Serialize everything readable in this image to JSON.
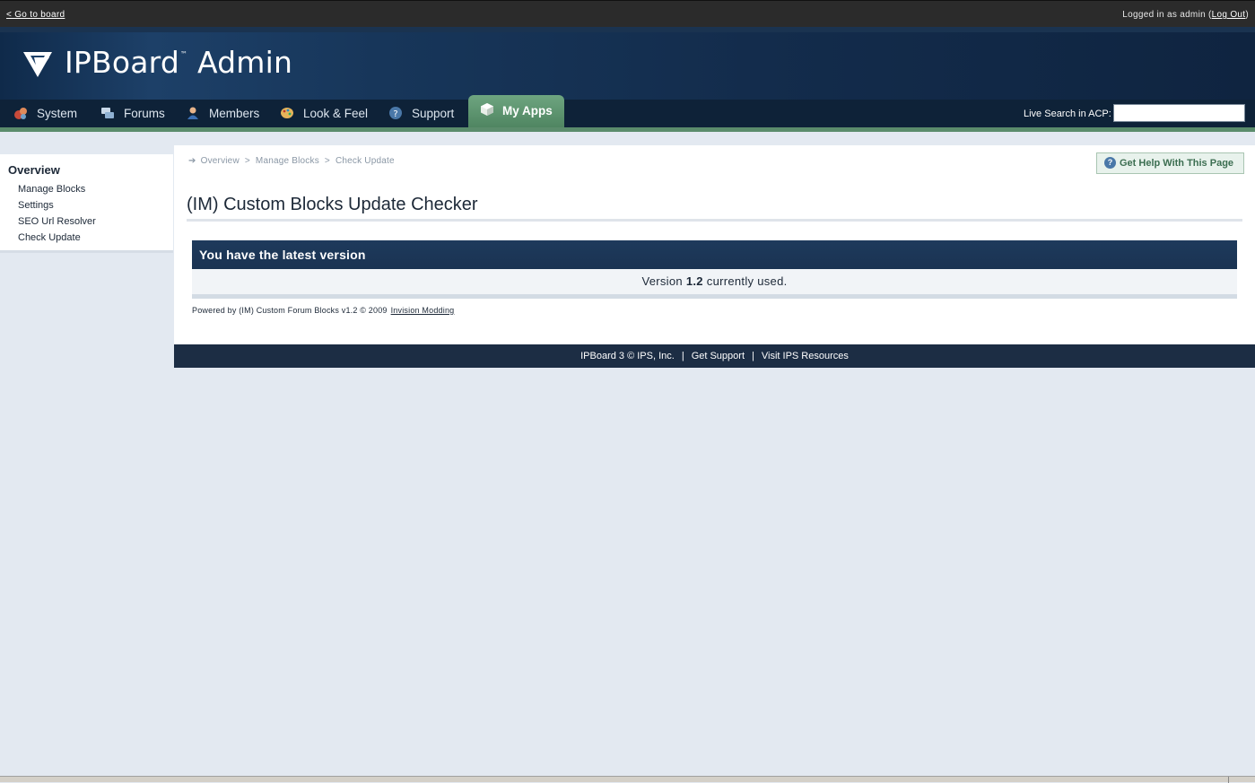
{
  "topbar": {
    "go_to_board": "< Go to board",
    "logged_in_prefix": "Logged in as admin (",
    "logout": "Log Out",
    "logged_in_suffix": ")"
  },
  "header": {
    "logo_text": "IPBoard",
    "logo_tm": "™",
    "logo_admin": "Admin"
  },
  "nav": {
    "tabs": [
      {
        "label": "System",
        "icon": "system-icon"
      },
      {
        "label": "Forums",
        "icon": "forums-icon"
      },
      {
        "label": "Members",
        "icon": "members-icon"
      },
      {
        "label": "Look & Feel",
        "icon": "look-feel-icon"
      },
      {
        "label": "Support",
        "icon": "support-icon"
      },
      {
        "label": "My Apps",
        "icon": "my-apps-icon",
        "active": true
      }
    ],
    "live_search_label": "Live Search in ACP:",
    "live_search_value": ""
  },
  "sidebar": {
    "title": "Overview",
    "items": [
      {
        "label": "Manage Blocks"
      },
      {
        "label": "Settings"
      },
      {
        "label": "SEO Url Resolver"
      },
      {
        "label": "Check Update"
      }
    ]
  },
  "breadcrumb": {
    "items": [
      "Overview",
      "Manage Blocks",
      "Check Update"
    ],
    "separator": ">"
  },
  "help_button": "Get Help With This Page",
  "page": {
    "title": "(IM) Custom Blocks Update Checker",
    "box_title": "You have the latest version",
    "version_prefix": "Version",
    "version": "1.2",
    "version_suffix": "currently used.",
    "powered_by": "Powered by (IM) Custom Forum Blocks v1.2 © 2009",
    "powered_link": "Invision Modding"
  },
  "footer": {
    "copyright": "IPBoard 3 © IPS, Inc.",
    "get_support": "Get Support",
    "visit_resources": "Visit IPS Resources",
    "separator": "|"
  },
  "colors": {
    "header_bg": "#132c4c",
    "nav_bg": "#0e2238",
    "active_tab": "#5b8c6c",
    "box_head": "#1e3a5c",
    "page_bg": "#e3e9f1"
  }
}
